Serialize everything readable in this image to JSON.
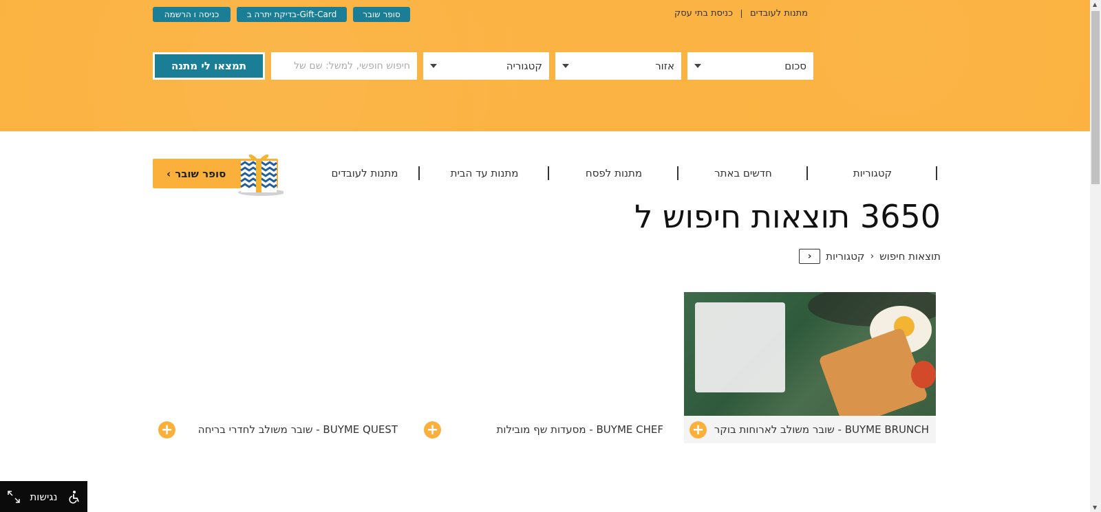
{
  "header": {
    "top_links": [
      "מתנות לעובדים",
      "כניסת בתי עסק"
    ],
    "top_buttons": {
      "voucher": "סופר שובר",
      "giftcard": "בדיקת יתרה ב-Gift-Card",
      "login": "כניסה  ו  הרשמה"
    },
    "search": {
      "amount_label": "סכום",
      "area_label": "אזור",
      "category_label": "קטגוריה",
      "input_placeholder": "חיפוש חופשי, למשל: שם של",
      "find_button": "תמצאו לי מתנה"
    },
    "background_color": "#fbb03b",
    "accent_color": "#1a7f96"
  },
  "nav": {
    "items": [
      "קטגוריות",
      "חדשים באתר",
      "מתנות לפסח",
      "מתנות עד הבית",
      "מתנות לעובדים"
    ],
    "voucher_button": "סופר שובר"
  },
  "page": {
    "title": "3650 תוצאות חיפוש ל",
    "breadcrumb": [
      "קטגוריות",
      "תוצאות חיפוש"
    ]
  },
  "products": [
    {
      "title": "BUYME BRUNCH - שובר משולב לארוחות בוקר"
    },
    {
      "title": "BUYME CHEF - מסעדות שף מובילות"
    },
    {
      "title": "BUYME QUEST - שובר משולב לחדרי בריחה"
    }
  ],
  "accessibility": {
    "label": "נגישות"
  }
}
